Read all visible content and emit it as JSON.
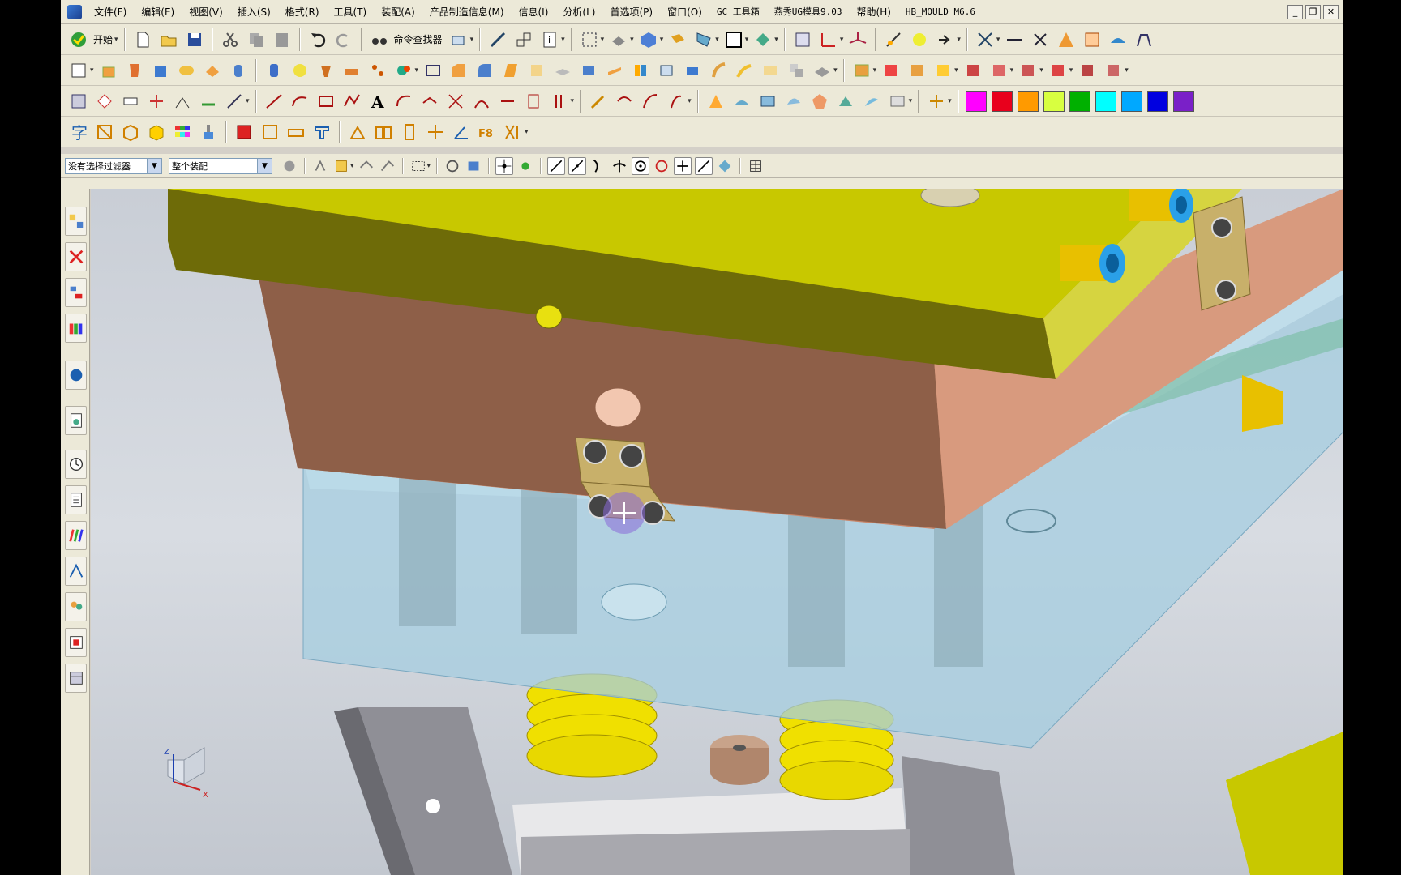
{
  "menu": {
    "items": [
      "文件(F)",
      "编辑(E)",
      "视图(V)",
      "插入(S)",
      "格式(R)",
      "工具(T)",
      "装配(A)",
      "产品制造信息(M)",
      "信息(I)",
      "分析(L)",
      "首选项(P)",
      "窗口(O)",
      "GC 工具箱",
      "燕秀UG模具9.03",
      "帮助(H)",
      "HB_MOULD M6.6"
    ]
  },
  "window_buttons": {
    "minimize": "_",
    "restore": "❐",
    "close": "✕"
  },
  "toolbar1": {
    "start_label": "开始",
    "command_finder_label": "命令查找器"
  },
  "selection_bar": {
    "filter_value": "没有选择过滤器",
    "scope_value": "整个装配"
  },
  "colors": {
    "palette": [
      "#ff00ff",
      "#e8001c",
      "#ff9a00",
      "#d8ff40",
      "#00b000",
      "#00ffff",
      "#00a8ff",
      "#0000e0",
      "#7a20c8"
    ],
    "plate_top": "#c8c800",
    "plate_copper": "#c8866a",
    "plate_glass": "#a6cde0",
    "spring": "#f0e000",
    "background": "#d0d4da"
  },
  "viewport": {
    "triad_x": "X",
    "triad_z": "Z"
  }
}
